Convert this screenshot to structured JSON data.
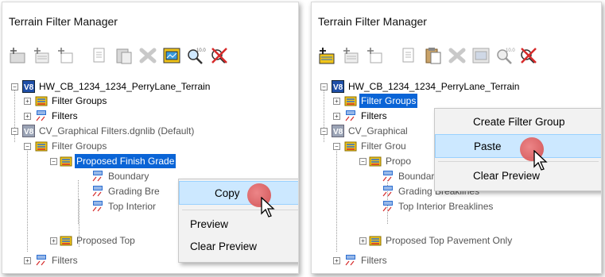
{
  "left": {
    "title": "Terrain Filter Manager",
    "tree": {
      "root1": "HW_CB_1234_1234_PerryLane_Terrain",
      "root1_filter_groups": "Filter Groups",
      "root1_filters": "Filters",
      "root2": "CV_Graphical Filters.dgnlib (Default)",
      "root2_filter_groups": "Filter Groups",
      "proposed_finish_grade": "Proposed Finish Grade",
      "boundary": "Boundary",
      "grading_breaklines": "Grading Bre",
      "top_interior": "Top Interior",
      "proposed_top": "Proposed Top",
      "root2_filters": "Filters"
    },
    "menu": {
      "copy": "Copy",
      "preview": "Preview",
      "clear_preview": "Clear Preview"
    }
  },
  "right": {
    "title": "Terrain Filter Manager",
    "tree": {
      "root1": "HW_CB_1234_1234_PerryLane_Terrain",
      "root1_filter_groups": "Filter Groups",
      "root1_filters": "Filters",
      "root2": "CV_Graphical",
      "root2_filter_groups": "Filter Grou",
      "proposed": "Propo",
      "boundary": "Boundary",
      "grading_breaklines": "Grading Breaklines",
      "top_interior": "Top Interior Breaklines",
      "proposed_top": "Proposed Top Pavement Only",
      "root2_filters": "Filters"
    },
    "menu": {
      "create_filter_group": "Create Filter Group",
      "paste": "Paste",
      "clear_preview": "Clear Preview"
    }
  },
  "colors": {
    "selection": "#0a64d6",
    "menu_highlight": "#cce8ff",
    "cursor_dot": "#d24545",
    "folder": "#f0c419",
    "delete_red": "#d62b2b"
  }
}
